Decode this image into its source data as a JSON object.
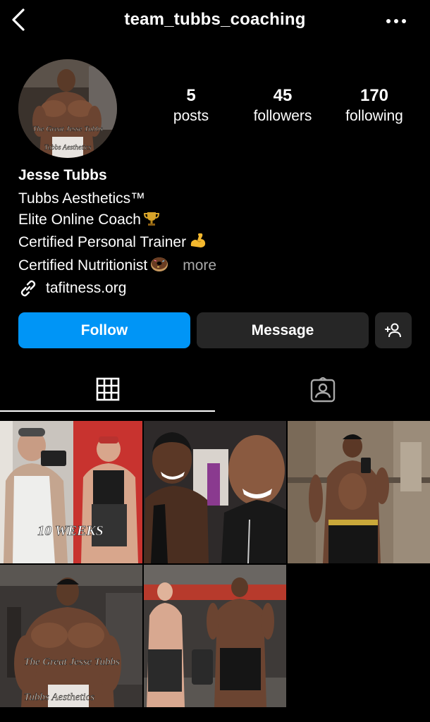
{
  "header": {
    "username": "team_tubbs_coaching"
  },
  "profile": {
    "avatar_caption_1": "The Great Jesse Tubbs",
    "avatar_caption_2": "Tubbs Aesthetics"
  },
  "stats": [
    {
      "value": "5",
      "label": "posts"
    },
    {
      "value": "45",
      "label": "followers"
    },
    {
      "value": "170",
      "label": "following"
    }
  ],
  "bio": {
    "name": "Jesse Tubbs",
    "lines": [
      "Tubbs Aesthetics™",
      "Elite Online Coach",
      "Certified Personal Trainer",
      "Certified Nutritionist"
    ],
    "more_label": "more",
    "link": "tafitness.org"
  },
  "actions": {
    "follow_label": "Follow",
    "message_label": "Message"
  },
  "tabs": [
    {
      "name": "posts-grid",
      "icon": "grid-icon",
      "active": true
    },
    {
      "name": "tagged",
      "icon": "tagged-user-icon",
      "active": false
    }
  ],
  "posts": [
    {
      "overlay_text": "10 WEEKS"
    },
    {
      "overlay_text": ""
    },
    {
      "overlay_text": ""
    },
    {
      "overlay_text": "The Great Jesse Tubbs",
      "overlay_text_2": "Tubbs Aesthetics"
    },
    {
      "overlay_text": ""
    }
  ],
  "colors": {
    "accent": "#0095f6",
    "secondary_button": "#262626",
    "muted_text": "#a8a8a8",
    "background": "#000000"
  }
}
